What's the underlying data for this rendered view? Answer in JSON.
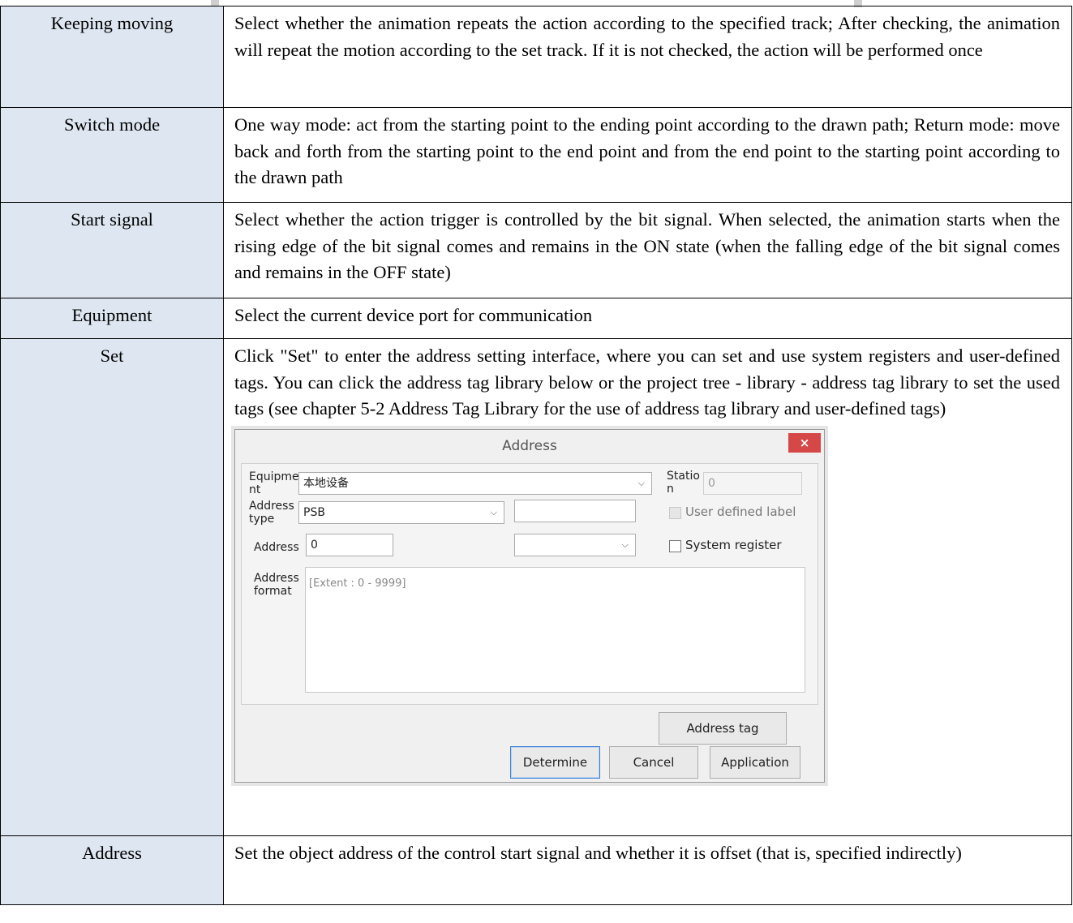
{
  "rows": [
    {
      "param": "Keeping moving",
      "desc": "Select whether the animation repeats the action according to the specified track; After checking, the animation will repeat the motion according to the set track. If it is not checked, the action will be performed once"
    },
    {
      "param": "Switch mode",
      "desc": "One way mode: act from the starting point to the ending point according to the drawn path; Return mode: move back and forth from the starting point to the end point and from the end point to the starting point according to the drawn path"
    },
    {
      "param": "Start signal",
      "desc": "Select whether the action trigger is controlled by the bit signal. When selected, the animation starts when the rising edge of the bit signal comes and remains in the ON state (when the falling edge of the bit signal comes and remains in the OFF state)"
    },
    {
      "param": "Equipment",
      "desc": "Select the current device port for communication"
    },
    {
      "param": "Set",
      "desc": "Click \"Set\" to enter the address setting interface, where you can set and use system registers and user-defined tags. You can click the address tag library below or the project tree - library - address tag library to set the used tags (see chapter 5-2 Address Tag Library for the use of address tag library and user-defined tags)"
    },
    {
      "param": "Address",
      "desc": "Set the object address of the control start signal and whether it is offset (that is, specified indirectly)"
    }
  ],
  "dialog": {
    "title": "Address",
    "close_glyph": "×",
    "equipment_label_1": "Equipme",
    "equipment_label_2": "nt",
    "equipment_value": "本地设备",
    "station_label_1": "Statio",
    "station_label_2": "n",
    "station_value": "0",
    "address_type_label_1": "Address",
    "address_type_label_2": "type",
    "address_type_value": "PSB",
    "address_type_extra_value": "",
    "user_defined_label": "User defined label",
    "user_defined_checked": false,
    "address_label": "Address",
    "address_value": "0",
    "address_sub_value": "",
    "system_register_label": "System register",
    "system_register_checked": false,
    "address_format_label_1": "Address",
    "address_format_label_2": "format",
    "address_format_value": "[Extent : 0 - 9999]",
    "address_tag_button": "Address tag",
    "determine_button": "Determine",
    "cancel_button": "Cancel",
    "application_button": "Application",
    "chevron_glyph": "⌵"
  }
}
